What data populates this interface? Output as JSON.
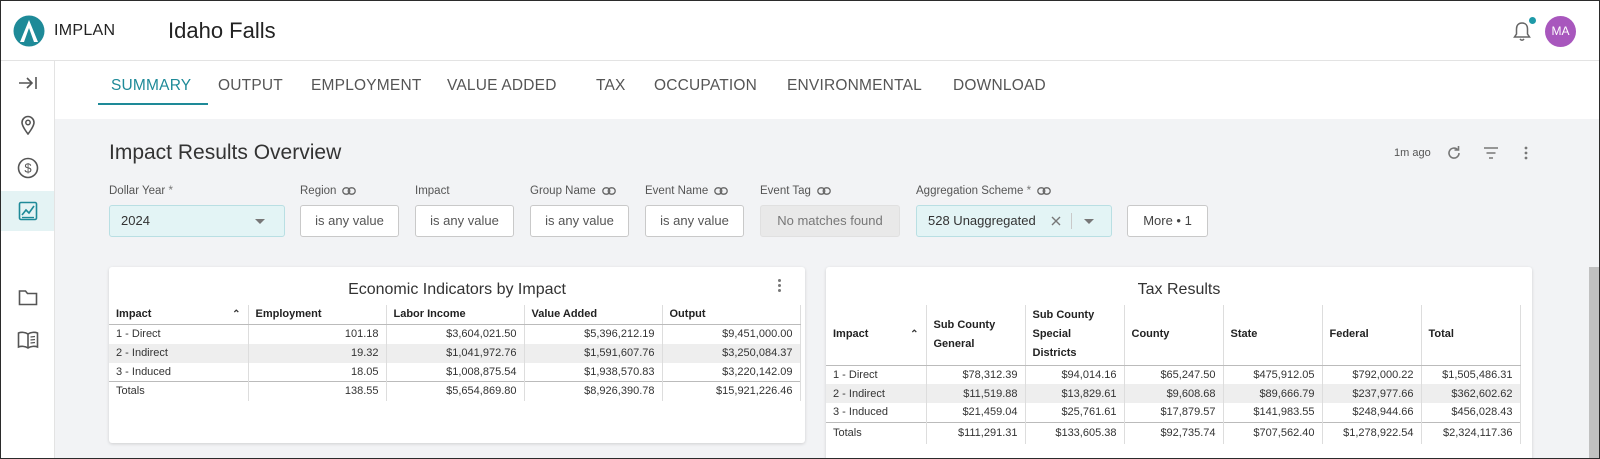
{
  "brand": {
    "name": "IMPLAN"
  },
  "app_title": "Idaho Falls",
  "user": {
    "initials": "MA",
    "avatar_color": "#a857bd"
  },
  "colors": {
    "accent": "#1e8a98",
    "notification": "#1e9aa8"
  },
  "rail": [
    {
      "icon": "arrow-right-to-bar-icon"
    },
    {
      "icon": "location-pin-icon"
    },
    {
      "icon": "dollar-circle-icon"
    },
    {
      "icon": "chart-icon",
      "active": true
    },
    {
      "icon": "folder-icon"
    },
    {
      "icon": "book-icon"
    }
  ],
  "tabs": [
    "SUMMARY",
    "OUTPUT",
    "EMPLOYMENT",
    "VALUE ADDED",
    "TAX",
    "OCCUPATION",
    "ENVIRONMENTAL",
    "DOWNLOAD"
  ],
  "active_tab": "SUMMARY",
  "page_title": "Impact Results Overview",
  "last_updated": "1m ago",
  "filters": {
    "dollar_year": {
      "label": "Dollar Year",
      "required": "*",
      "value": "2024"
    },
    "region": {
      "label": "Region",
      "value": "is any value"
    },
    "impact": {
      "label": "Impact",
      "value": "is any value"
    },
    "group_name": {
      "label": "Group Name",
      "value": "is any value"
    },
    "event_name": {
      "label": "Event Name",
      "value": "is any value"
    },
    "event_tag": {
      "label": "Event Tag",
      "value": "No matches found"
    },
    "aggregation_scheme": {
      "label": "Aggregation Scheme",
      "required": "*",
      "value": "528 Unaggregated"
    },
    "more": "More • 1"
  },
  "economic": {
    "title": "Economic Indicators by Impact",
    "columns": [
      "Impact",
      "Employment",
      "Labor Income",
      "Value Added",
      "Output"
    ],
    "rows": [
      [
        "1 - Direct",
        "101.18",
        "$3,604,021.50",
        "$5,396,212.19",
        "$9,451,000.00"
      ],
      [
        "2 - Indirect",
        "19.32",
        "$1,041,972.76",
        "$1,591,607.76",
        "$3,250,084.37"
      ],
      [
        "3 - Induced",
        "18.05",
        "$1,008,875.54",
        "$1,938,570.83",
        "$3,220,142.09"
      ]
    ],
    "totals": [
      "Totals",
      "138.55",
      "$5,654,869.80",
      "$8,926,390.78",
      "$15,921,226.46"
    ]
  },
  "tax": {
    "title": "Tax Results",
    "columns": [
      "Impact",
      "Sub County General",
      "Sub County Special Districts",
      "County",
      "State",
      "Federal",
      "Total"
    ],
    "rows": [
      [
        "1 - Direct",
        "$78,312.39",
        "$94,014.16",
        "$65,247.50",
        "$475,912.05",
        "$792,000.22",
        "$1,505,486.31"
      ],
      [
        "2 - Indirect",
        "$11,519.88",
        "$13,829.61",
        "$9,608.68",
        "$89,666.79",
        "$237,977.66",
        "$362,602.62"
      ],
      [
        "3 - Induced",
        "$21,459.04",
        "$25,761.61",
        "$17,879.57",
        "$141,983.55",
        "$248,944.66",
        "$456,028.43"
      ]
    ],
    "totals": [
      "Totals",
      "$111,291.31",
      "$133,605.38",
      "$92,735.74",
      "$707,562.40",
      "$1,278,922.54",
      "$2,324,117.36"
    ]
  }
}
